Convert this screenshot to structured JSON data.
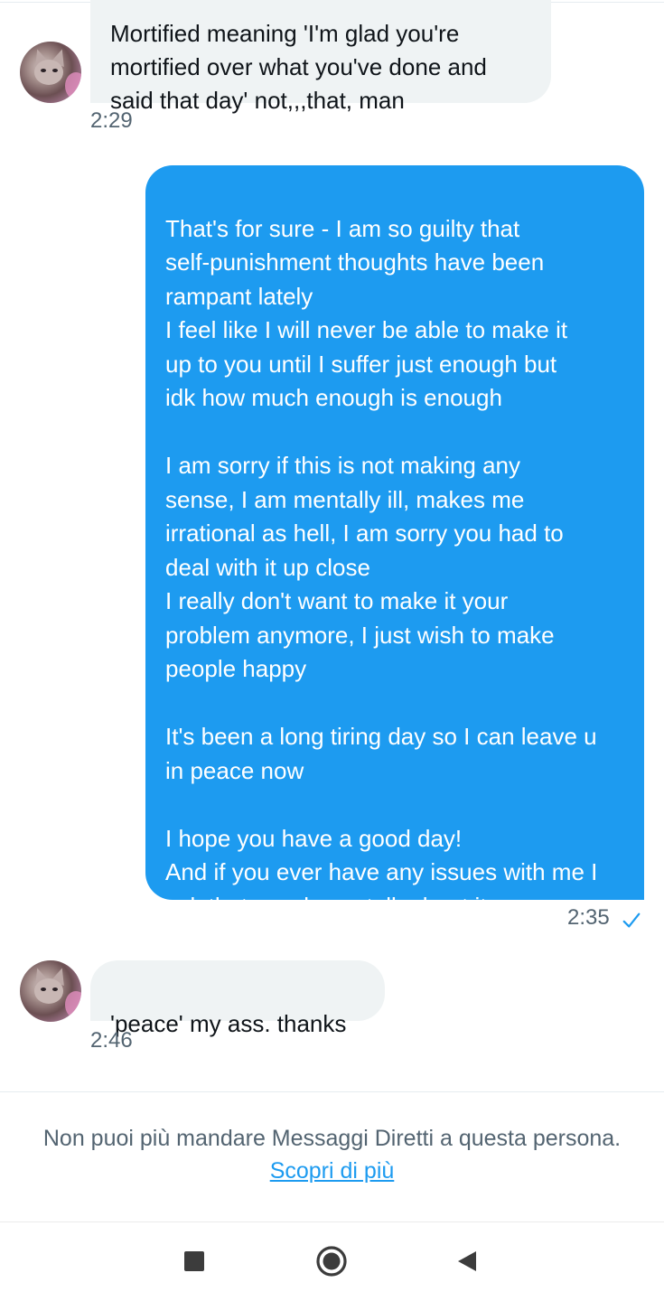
{
  "thread": {
    "messages": [
      {
        "direction": "incoming",
        "text": "Mortified meaning 'I'm glad you're\nmortified over what you've done and\nsaid that day' not,,,that, man",
        "time": "2:29"
      },
      {
        "direction": "outgoing",
        "text": "That's for sure - I am so guilty that\nself-punishment thoughts have been\nrampant lately\nI feel like I will never be able to make it\nup to you until I suffer just enough but\nidk how much enough is enough\n\nI am sorry if this is not making any\nsense, I am mentally ill, makes me\nirrational as hell, I am sorry you had to\ndeal with it up close\nI really don't want to make it your\nproblem anymore, I just wish to make\npeople happy\n\nIt's been a long tiring day so I can leave u\nin peace now\n\nI hope you have a good day!\nAnd if you ever have any issues with me I\nask that we please talk about it",
        "time": "2:35",
        "status_icon": "check-icon"
      },
      {
        "direction": "incoming",
        "text": "'peace' my ass. thanks",
        "time": "2:46"
      }
    ]
  },
  "notice": {
    "text": "Non puoi più mandare Messaggi Diretti a questa persona.",
    "link": "Scopri di più"
  },
  "navbar": {
    "buttons": [
      "recents-square-icon",
      "home-circle-icon",
      "back-triangle-icon"
    ]
  },
  "colors": {
    "outgoing_bubble": "#1d9bf0",
    "incoming_bubble": "#eff3f4",
    "link": "#1d9bf0",
    "muted_text": "#536471"
  }
}
